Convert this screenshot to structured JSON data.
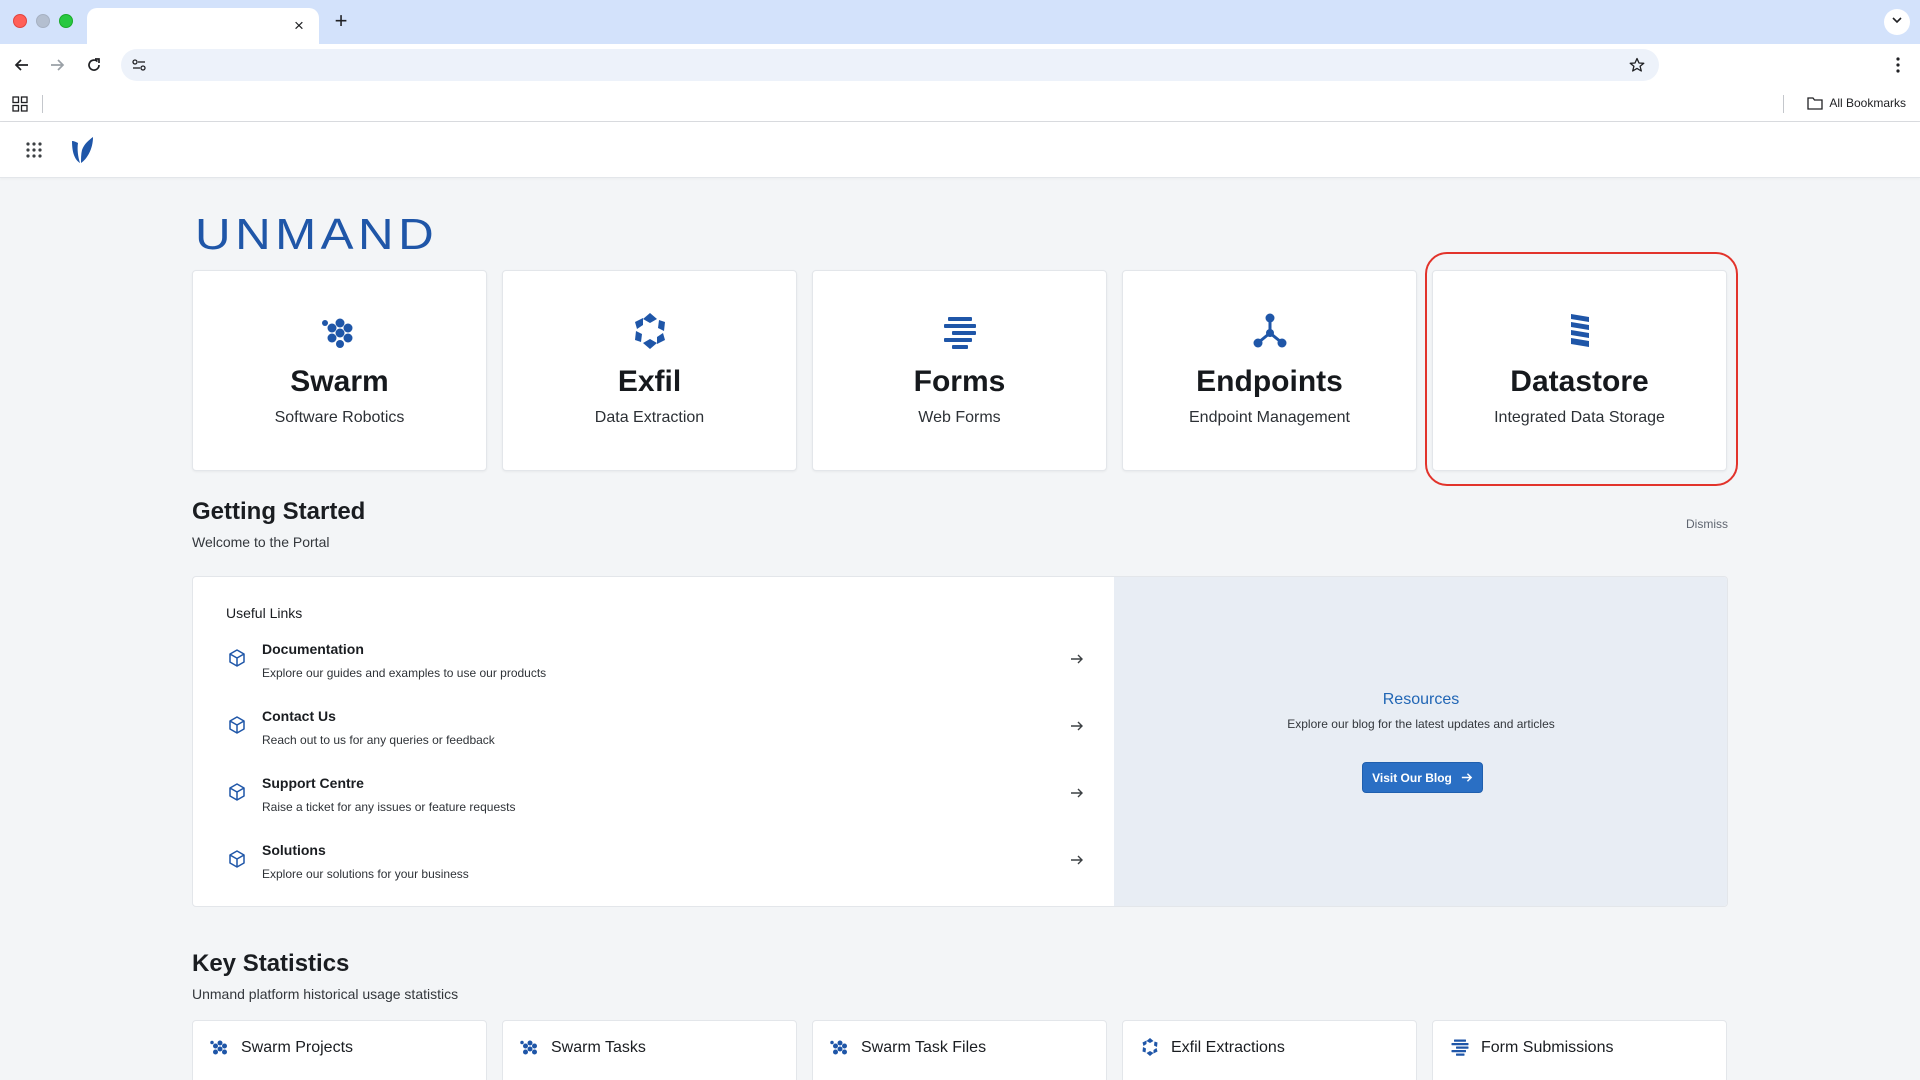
{
  "browser": {
    "tab_close": "×",
    "new_tab": "+",
    "address_value": "",
    "all_bookmarks": "All Bookmarks"
  },
  "brand": "UNMAND",
  "products": [
    {
      "name": "Swarm",
      "subtitle": "Software Robotics",
      "icon": "swarm-icon"
    },
    {
      "name": "Exfil",
      "subtitle": "Data Extraction",
      "icon": "exfil-icon"
    },
    {
      "name": "Forms",
      "subtitle": "Web Forms",
      "icon": "forms-icon"
    },
    {
      "name": "Endpoints",
      "subtitle": "Endpoint Management",
      "icon": "endpoints-icon"
    },
    {
      "name": "Datastore",
      "subtitle": "Integrated Data Storage",
      "icon": "datastore-icon"
    }
  ],
  "getting_started": {
    "title": "Getting Started",
    "subtitle": "Welcome to the Portal",
    "dismiss": "Dismiss",
    "useful_links_title": "Useful Links",
    "links": [
      {
        "title": "Documentation",
        "desc": "Explore our guides and examples to use our products"
      },
      {
        "title": "Contact Us",
        "desc": "Reach out to us for any queries or feedback"
      },
      {
        "title": "Support Centre",
        "desc": "Raise a ticket for any issues or feature requests"
      },
      {
        "title": "Solutions",
        "desc": "Explore our solutions for your business"
      }
    ],
    "resources": {
      "title": "Resources",
      "subtitle": "Explore our blog for the latest updates and articles",
      "button": "Visit Our Blog"
    }
  },
  "key_statistics": {
    "title": "Key Statistics",
    "subtitle": "Unmand platform historical usage statistics",
    "cards": [
      {
        "label": "Swarm Projects",
        "icon": "swarm-icon"
      },
      {
        "label": "Swarm Tasks",
        "icon": "swarm-icon"
      },
      {
        "label": "Swarm Task Files",
        "icon": "swarm-icon"
      },
      {
        "label": "Exfil Extractions",
        "icon": "exfil-icon"
      },
      {
        "label": "Form Submissions",
        "icon": "forms-icon"
      }
    ]
  },
  "colors": {
    "brand_blue": "#1f56a8",
    "button_blue": "#2a6fc4",
    "highlight_red": "#e2332b"
  }
}
